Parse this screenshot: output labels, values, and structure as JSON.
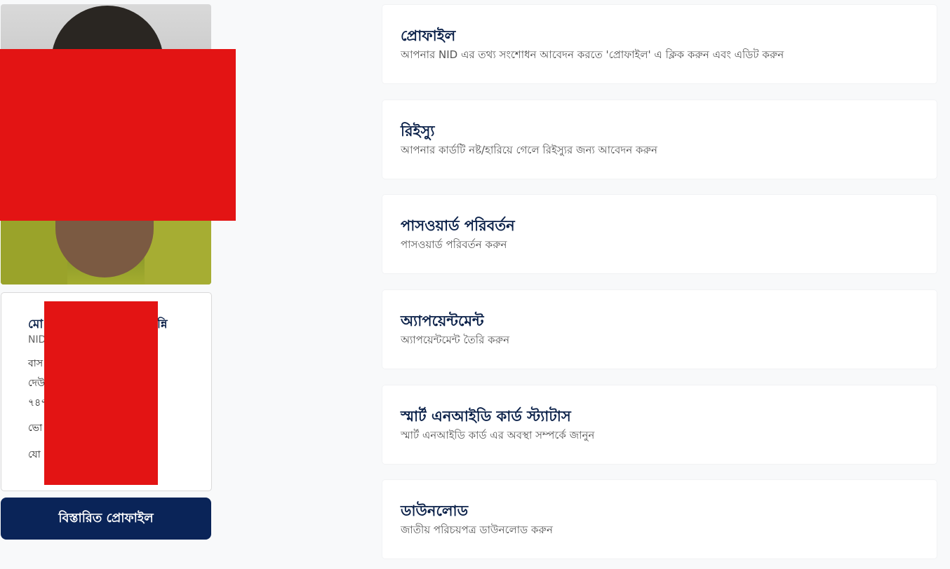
{
  "profile": {
    "name_start": "মো",
    "name_end": "ন্নি",
    "nid_label": "NID",
    "lines": [
      "বাস",
      "দেউ",
      "৭৪৭",
      "ভো",
      "যো"
    ],
    "detail_button_label": "বিস্তারিত প্রোফাইল"
  },
  "menu": {
    "items": [
      {
        "title": "প্রোফাইল",
        "description": "আপনার NID এর তথ্য সংশোধন আবেদন করতে 'প্রোফাইল' এ ক্লিক করুন এবং এডিট করুন"
      },
      {
        "title": "রিইস্যু",
        "description": "আপনার কার্ডটি নষ্ট/হারিয়ে গেলে রিইস্যুর জন্য আবেদন করুন"
      },
      {
        "title": "পাসওয়ার্ড পরিবর্তন",
        "description": "পাসওয়ার্ড পরিবর্তন করুন"
      },
      {
        "title": "অ্যাপয়েন্টমেন্ট",
        "description": "অ্যাপয়েন্টমেন্ট তৈরি করুন"
      },
      {
        "title": "স্মার্ট এনআইডি কার্ড স্ট্যাটাস",
        "description": "স্মার্ট এনআইডি কার্ড এর অবস্থা সম্পর্কে জানুন"
      },
      {
        "title": "ডাউনলোড",
        "description": "জাতীয় পরিচয়পত্র ডাউনলোড করুন"
      }
    ]
  },
  "colors": {
    "primary": "#0a2458",
    "redaction": "#e31414",
    "background": "#f8f9fa"
  }
}
